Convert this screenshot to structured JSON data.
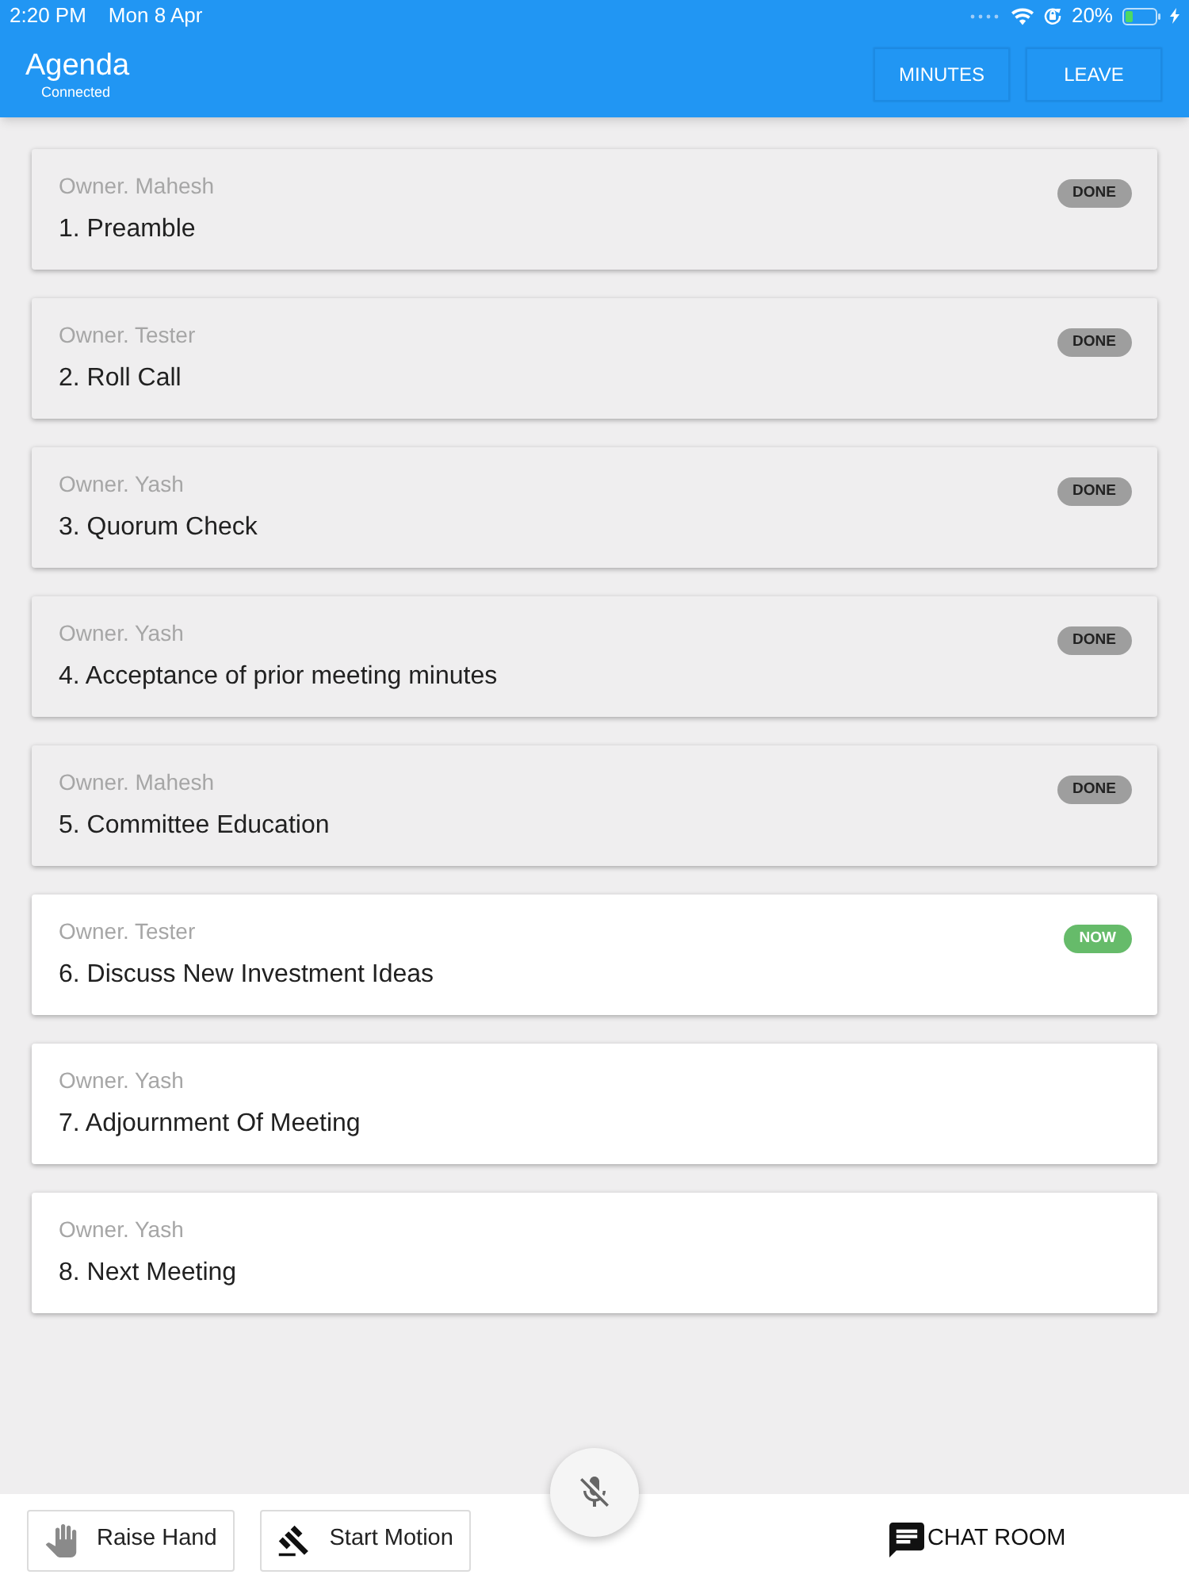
{
  "status_bar": {
    "time": "2:20 PM",
    "date": "Mon 8 Apr",
    "battery": "20%"
  },
  "app_bar": {
    "title": "Agenda",
    "subtitle": "Connected",
    "buttons": [
      "MINUTES",
      "LEAVE"
    ]
  },
  "agenda_items": [
    {
      "owner": "Owner. Mahesh",
      "title": "1. Preamble",
      "kind": "done",
      "badge": "DONE"
    },
    {
      "owner": "Owner. Tester",
      "title": "2. Roll Call",
      "kind": "done",
      "badge": "DONE"
    },
    {
      "owner": "Owner. Yash",
      "title": "3. Quorum Check",
      "kind": "done",
      "badge": "DONE"
    },
    {
      "owner": "Owner. Yash",
      "title": "4. Acceptance of prior meeting minutes",
      "kind": "done",
      "badge": "DONE"
    },
    {
      "owner": "Owner. Mahesh",
      "title": "5. Committee Education",
      "kind": "done",
      "badge": "DONE"
    },
    {
      "owner": "Owner. Tester",
      "title": "6. Discuss New Investment Ideas",
      "kind": "now",
      "badge": "NOW"
    },
    {
      "owner": "Owner. Yash",
      "title": "7. Adjournment Of Meeting",
      "kind": "upcoming"
    },
    {
      "owner": "Owner. Yash",
      "title": "8. Next Meeting",
      "kind": "upcoming"
    }
  ],
  "bottom_bar": {
    "buttons": [
      {
        "label": "Raise Hand",
        "kind": "hand"
      },
      {
        "label": "Start Motion",
        "kind": "gavel"
      }
    ],
    "mic": {
      "muted": true
    },
    "chat": {
      "label": "CHAT ROOM"
    }
  }
}
